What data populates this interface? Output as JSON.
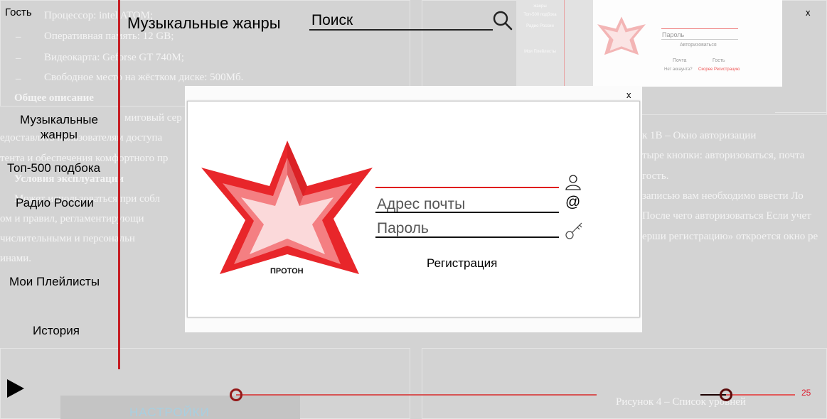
{
  "window": {
    "close_label": "x"
  },
  "header": {
    "guest_label": "Гость",
    "title": "Музыкальные жанры",
    "search_placeholder": "Поиск"
  },
  "sidebar": {
    "items": [
      {
        "label": "Музыкальные жанры"
      },
      {
        "label": "Топ-500 подбока"
      },
      {
        "label": "Радио России"
      },
      {
        "label": "Мои Плейлисты"
      },
      {
        "label": "История"
      }
    ]
  },
  "player": {
    "progress_fraction": 0.0,
    "volume": 25,
    "volume_label": "25"
  },
  "auth_modal": {
    "close_label": "x",
    "logo_text": "ПРОТОН",
    "login_placeholder": "",
    "email_placeholder": "Адрес почты",
    "password_placeholder": "Пароль",
    "register_link": "Регистрация",
    "accent_color": "#e01d1d"
  },
  "background_document": {
    "lines": [
      "Процессор: intel ATOM;",
      "Оперативная память: 12 GB;",
      "Видеокарта: Geforse GT 740M;",
      "Свободное место на жёстком диске: 500Мб.",
      "Общее описание",
      "миговый сер",
      "едоставлять пользователям доступа",
      "тента и обеспечения комфортного пр",
      "Условия эксплуатации",
      "Может использоваться при собл",
      "ом и правил, регламентирующи",
      "числительными и персональн",
      "инами.",
      "к 1В – Окно авторизации",
      "тыре кнопки: авторизоваться, почта",
      "гость.",
      "записью вам необходимо ввести Ло",
      "После чего авторизоваться Если учет",
      "ерши регистрацию» откроется окно ре",
      "Рисунок 4 – Список уровней"
    ],
    "thumbnail": {
      "sidebar_items": [
        "жанры",
        "Топ-500 подбока",
        "Радио России",
        "Мои Плейлисты"
      ],
      "password_label": "Пароль",
      "login_button": "Авторизоваться",
      "mail_label": "Почта",
      "guest_label": "Гость",
      "no_account": "Нет аккаунта?",
      "register_link": "Скорее Регистрацию"
    },
    "settings_thumb_label": "НАСТРОЙКИ"
  }
}
